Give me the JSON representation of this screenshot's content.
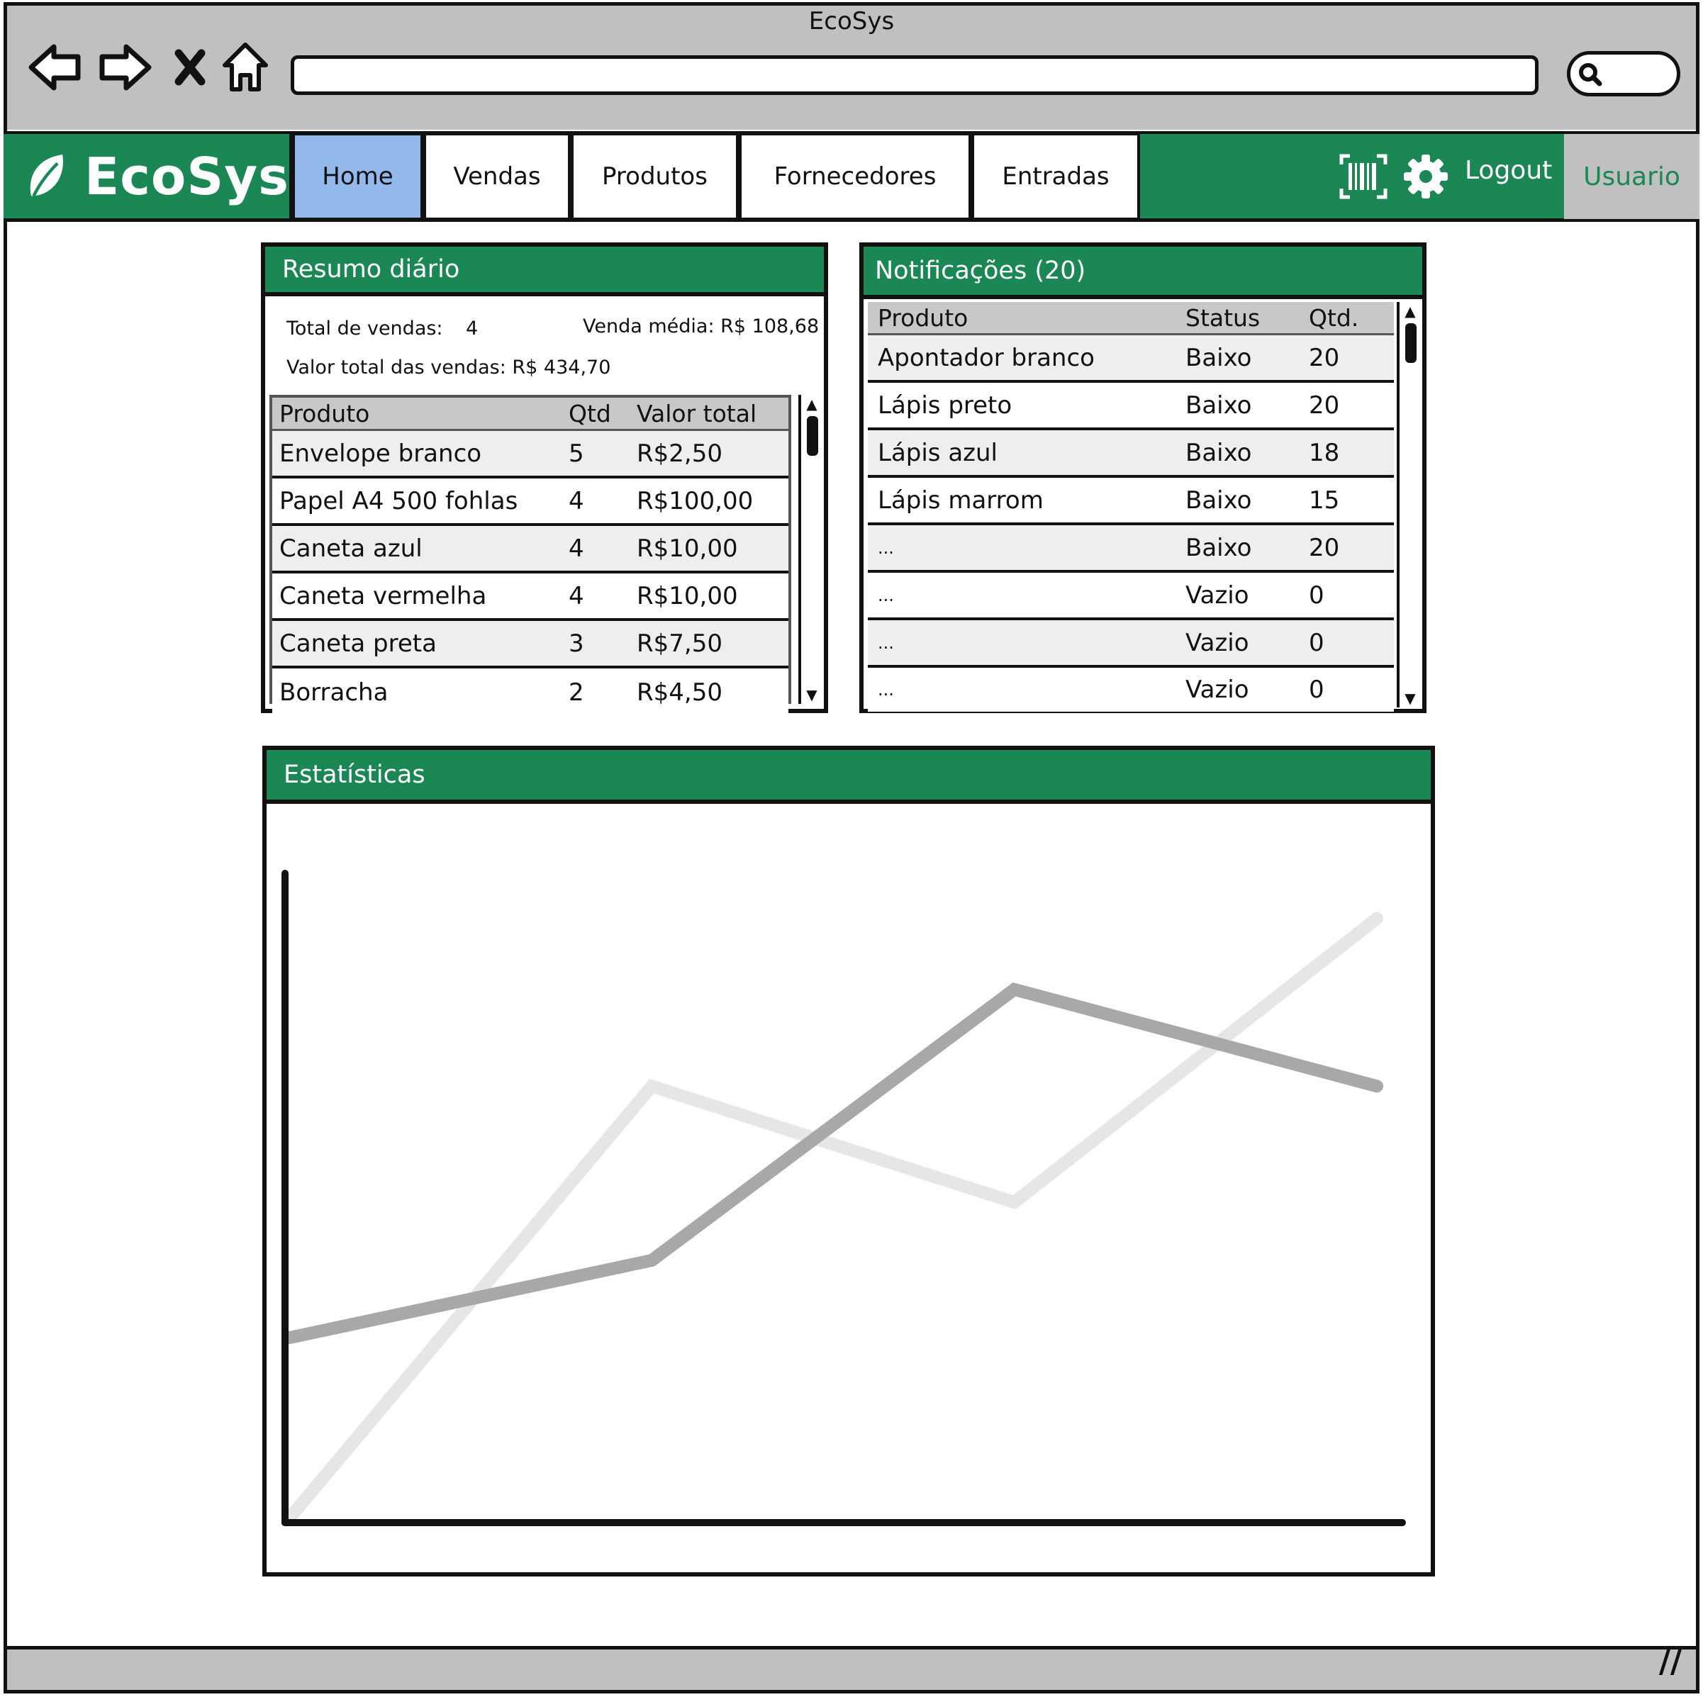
{
  "window": {
    "title": "EcoSys"
  },
  "browser_icons": {
    "back": "arrow-left-icon",
    "forward": "arrow-right-icon",
    "stop": "close-icon",
    "home": "home-icon",
    "search": "search-icon"
  },
  "app": {
    "brand": "EcoSys",
    "logo_icon": "leaf-icon",
    "brand_color": "#1a8755",
    "active_tab_color": "#93b9ec"
  },
  "nav": {
    "tabs": [
      {
        "label": "Home",
        "active": true
      },
      {
        "label": "Vendas"
      },
      {
        "label": "Produtos"
      },
      {
        "label": "Fornecedores"
      },
      {
        "label": "Entradas"
      }
    ],
    "barcode_icon": "barcode-icon",
    "settings_icon": "gear-icon",
    "logout_label": "Logout",
    "user_label": "Usuario"
  },
  "resumo": {
    "title": "Resumo diário",
    "total_vendas_label": "Total de vendas:",
    "total_vendas_value": "4",
    "venda_media": "Venda média: R$ 108,68",
    "valor_total": "Valor total das vendas: R$ 434,70",
    "columns": [
      "Produto",
      "Qtd",
      "Valor total"
    ],
    "rows": [
      [
        "Envelope branco",
        "5",
        "R$2,50"
      ],
      [
        "Papel A4 500 fohlas",
        "4",
        "R$100,00"
      ],
      [
        "Caneta azul",
        "4",
        "R$10,00"
      ],
      [
        "Caneta vermelha",
        "4",
        "R$10,00"
      ],
      [
        "Caneta preta",
        "3",
        "R$7,50"
      ],
      [
        "Borracha",
        "2",
        "R$4,50"
      ]
    ]
  },
  "notificacoes": {
    "title": "Notificações (20)",
    "columns": [
      "Produto",
      "Status",
      "Qtd."
    ],
    "rows": [
      [
        "Apontador branco",
        "Baixo",
        "20"
      ],
      [
        "Lápis preto",
        "Baixo",
        "20"
      ],
      [
        "Lápis azul",
        "Baixo",
        "18"
      ],
      [
        "Lápis marrom",
        "Baixo",
        "15"
      ],
      [
        "...",
        "Baixo",
        "20"
      ],
      [
        "...",
        "Vazio",
        "0"
      ],
      [
        "...",
        "Vazio",
        "0"
      ],
      [
        "...",
        "Vazio",
        "0"
      ]
    ]
  },
  "estatisticas": {
    "title": "Estatísticas"
  },
  "chart_data": {
    "type": "line",
    "title": "",
    "xlabel": "",
    "ylabel": "",
    "x": [
      0,
      1,
      2,
      3
    ],
    "xlim": [
      0,
      3
    ],
    "ylim": [
      0,
      100
    ],
    "grid": false,
    "series": [
      {
        "values": [
          0,
          67,
          49,
          93
        ],
        "color": "#e6e6e6"
      },
      {
        "values": [
          28,
          40,
          82,
          67
        ],
        "color": "#a8a8a8"
      }
    ]
  }
}
